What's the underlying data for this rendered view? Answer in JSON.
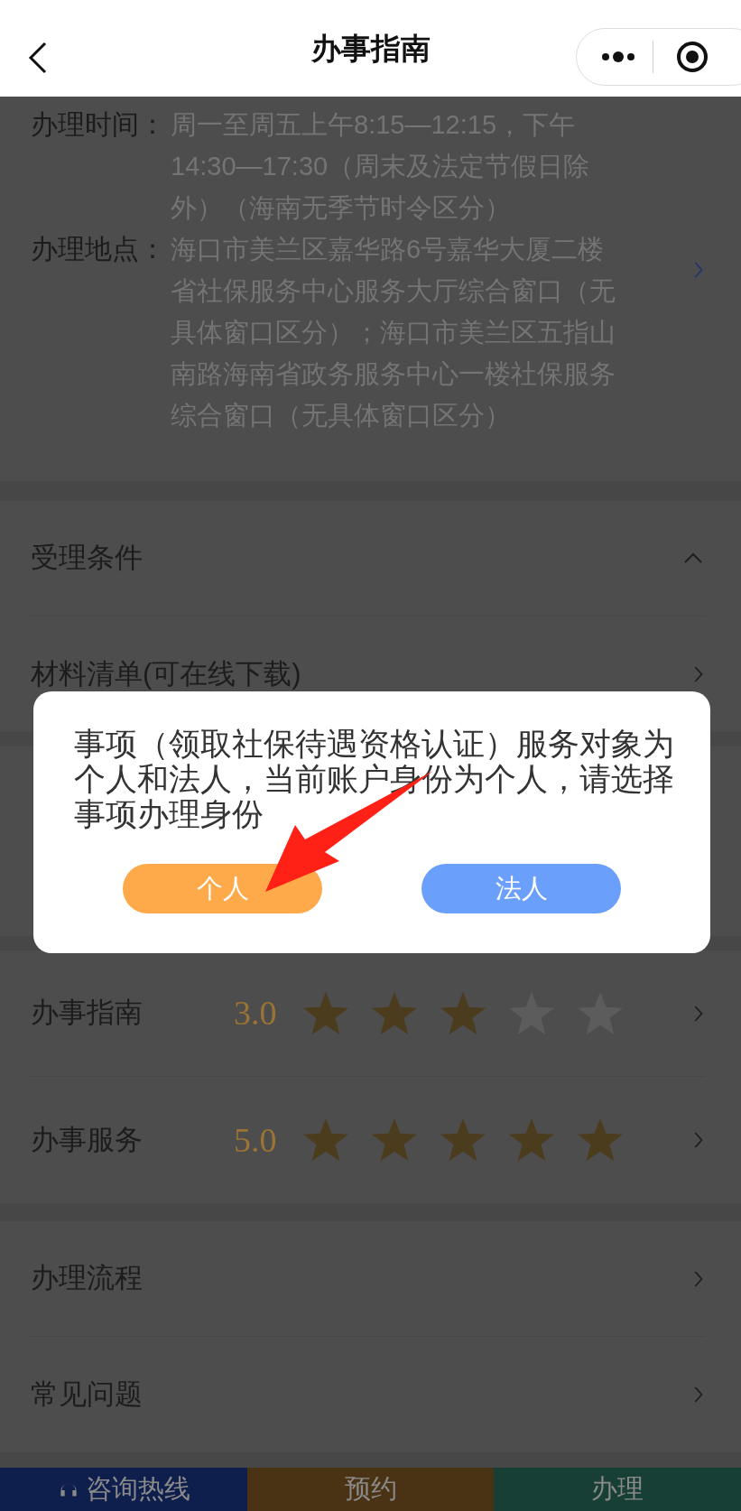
{
  "header": {
    "title": "办事指南"
  },
  "info": [
    {
      "label": "办理时间：",
      "value": "周一至周五上午8:15—12:15，下午14:30—17:30（周末及法定节假日除外）（海南无季节时令区分）"
    },
    {
      "label": "办理地点：",
      "value": "海口市美兰区嘉华路6号嘉华大厦二楼省社保服务中心服务大厅综合窗口（无具体窗口区分）；海口市美兰区五指山南路海南省政务服务中心一楼社保服务综合窗口（无具体窗口区分）"
    }
  ],
  "sections": [
    {
      "label": "受理条件",
      "kind": "accordion",
      "expanded": true
    },
    {
      "label": "材料清单(可在线下载)",
      "kind": "link"
    }
  ],
  "ratings": [
    {
      "label": "办事指南",
      "score": "3.0",
      "stars": 3
    },
    {
      "label": "办事服务",
      "score": "5.0",
      "stars": 5
    }
  ],
  "links": [
    "办理流程",
    "常见问题"
  ],
  "bottom_bar": [
    {
      "label": "咨询热线",
      "kind": "hotline",
      "color": "#0f1f4d"
    },
    {
      "label": "预约",
      "kind": "plain",
      "color": "#4a3214"
    },
    {
      "label": "办理",
      "kind": "plain",
      "color": "#173f35"
    }
  ],
  "dialog": {
    "message": "事项（领取社保待遇资格认证）服务对象为个人和法人，当前账户身份为个人，请选择事项办理身份",
    "buttons": [
      {
        "label": "个人",
        "color": "#ffaa4a"
      },
      {
        "label": "法人",
        "color": "#6b9ffc"
      }
    ]
  }
}
